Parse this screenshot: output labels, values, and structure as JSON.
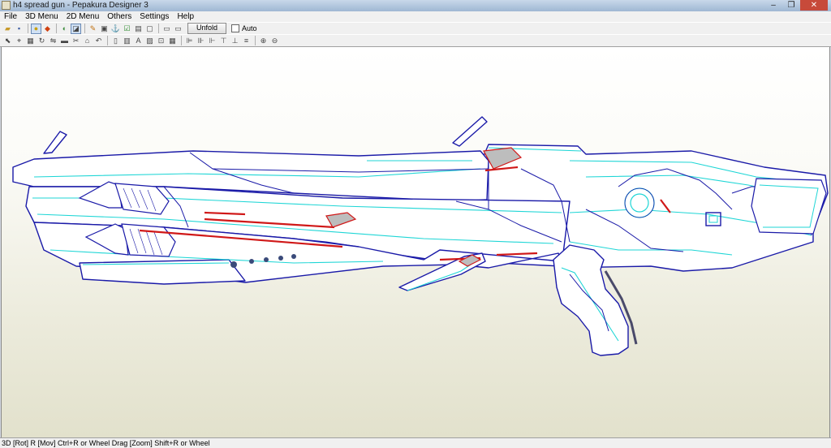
{
  "window": {
    "title": "h4 spread gun - Pepakura Designer 3",
    "controls": [
      "–",
      "❐",
      "✕"
    ]
  },
  "menu": [
    "File",
    "3D Menu",
    "2D Menu",
    "Others",
    "Settings",
    "Help"
  ],
  "toolbar": {
    "unfold_label": "Unfold",
    "auto_label": "Auto",
    "auto_checked": false
  },
  "status": {
    "text": "3D [Rot] R [Mov] Ctrl+R or Wheel Drag [Zoom] Shift+R or Wheel"
  },
  "colors": {
    "edge_blue": "#1a1aa8",
    "edge_cyan": "#1fd6d6",
    "edge_red": "#d01818",
    "face_gray": "#bdbdbd"
  }
}
